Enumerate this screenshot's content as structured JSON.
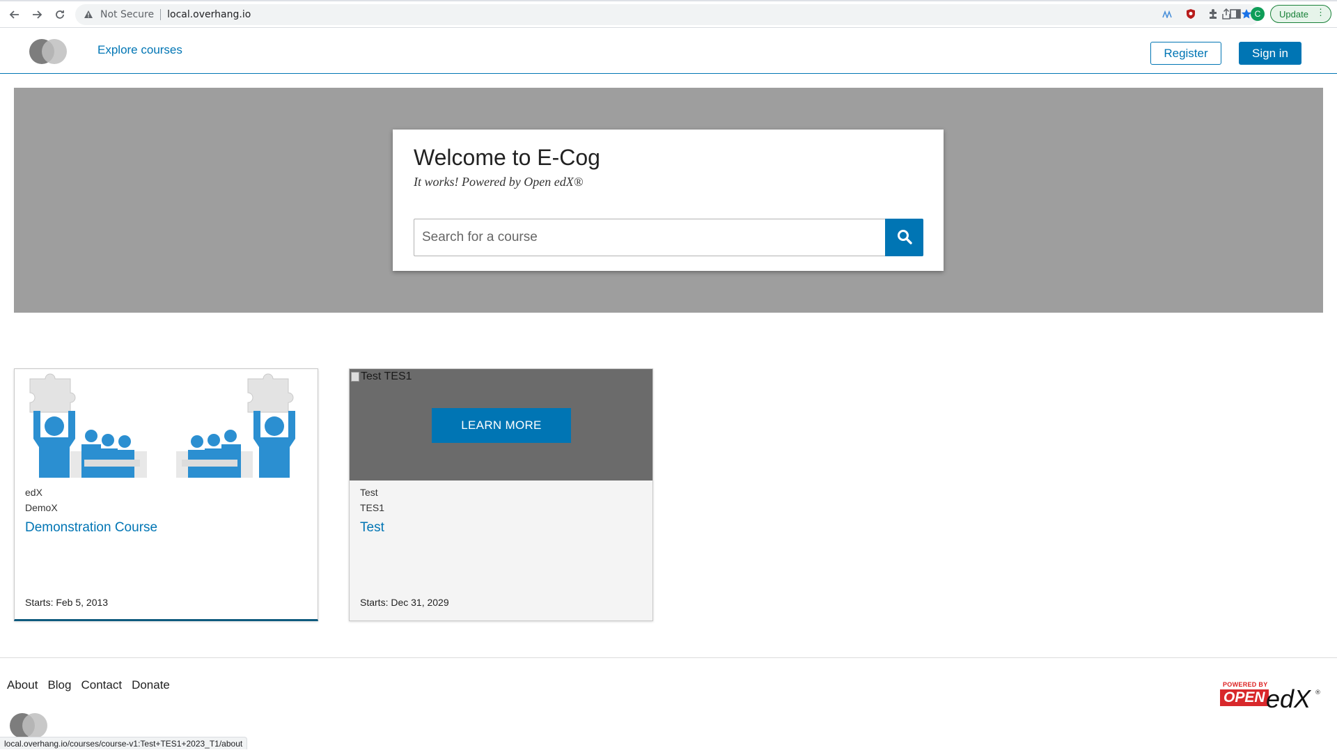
{
  "browser": {
    "security_label": "Not Secure",
    "url": "local.overhang.io",
    "profile_initial": "C",
    "update_label": "Update",
    "status_url": "local.overhang.io/courses/course-v1:Test+TES1+2023_T1/about"
  },
  "header": {
    "explore_label": "Explore courses",
    "register_label": "Register",
    "signin_label": "Sign in"
  },
  "hero": {
    "title": "Welcome to E-Cog",
    "subtitle": "It works! Powered by Open edX®",
    "search_placeholder": "Search for a course"
  },
  "courses": [
    {
      "org": "edX",
      "code": "DemoX",
      "title": "Demonstration Course",
      "start": "Starts: Feb 5, 2013"
    },
    {
      "image_alt": "Test TES1",
      "hover_label": "LEARN MORE",
      "org": "Test",
      "code": "TES1",
      "title": "Test",
      "start": "Starts: Dec 31, 2029"
    }
  ],
  "footer": {
    "links": [
      "About",
      "Blog",
      "Contact",
      "Donate"
    ],
    "powered_by": "POWERED BY",
    "powered_open": "OPEN",
    "powered_edx": "edX"
  },
  "colors": {
    "brand_primary": "#0075b4",
    "hero_bg": "#9e9e9e",
    "edx_red": "#d8282b"
  }
}
